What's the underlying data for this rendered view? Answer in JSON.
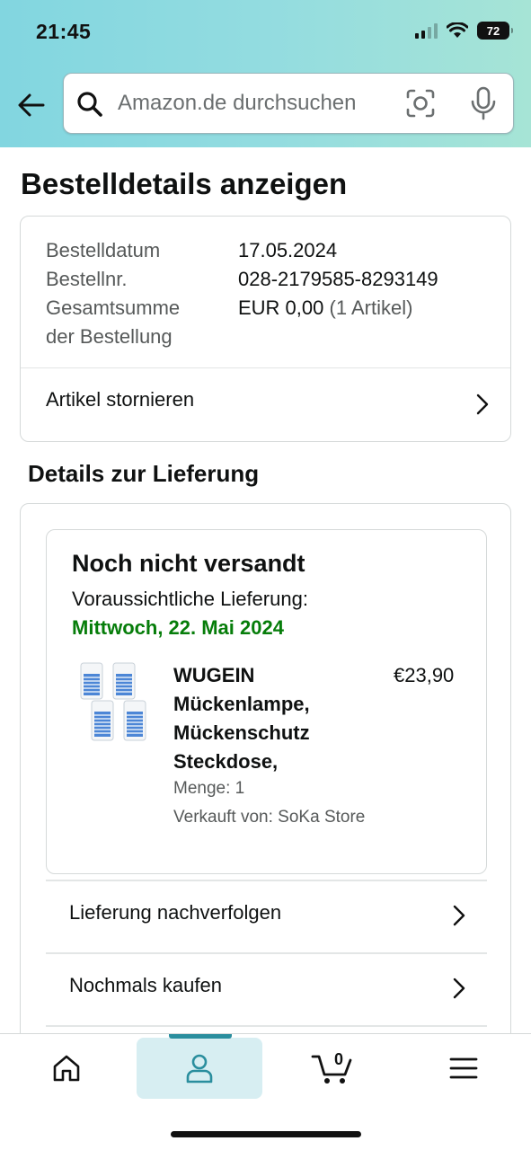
{
  "status_bar": {
    "time": "21:45",
    "battery": "72"
  },
  "header": {
    "search_placeholder": "Amazon.de durchsuchen"
  },
  "page_title": "Bestelldetails anzeigen",
  "order_summary": {
    "date_label": "Bestelldatum",
    "date_value": "17.05.2024",
    "number_label": "Bestellnr.",
    "number_value": "028-2179585-8293149",
    "total_label_line1": "Gesamtsumme",
    "total_label_line2": "der Bestellung",
    "total_value": "EUR 0,00",
    "item_count": "(1 Artikel)",
    "cancel_label": "Artikel stornieren"
  },
  "delivery": {
    "section_title": "Details zur Lieferung",
    "status": "Noch nicht versandt",
    "eta_label": "Voraussichtliche Lieferung:",
    "eta_date": "Mittwoch, 22. Mai 2024",
    "product": {
      "name_line1": "WUGEIN",
      "name_line2": "Mückenlampe,",
      "name_line3": "Mückenschutz",
      "name_line4": "Steckdose,",
      "price": "€23,90",
      "quantity": "Menge: 1",
      "seller": "Verkauft von: SoKa Store"
    },
    "actions": [
      {
        "label": "Lieferung nachverfolgen"
      },
      {
        "label": "Nochmals kaufen"
      }
    ]
  },
  "tabbar": {
    "cart_count": "0"
  },
  "colors": {
    "accent_teal": "#2a8e9e",
    "delivery_green": "#067d0a",
    "header_gradient_start": "#82d6e0",
    "header_gradient_end": "#a6e4d6"
  }
}
